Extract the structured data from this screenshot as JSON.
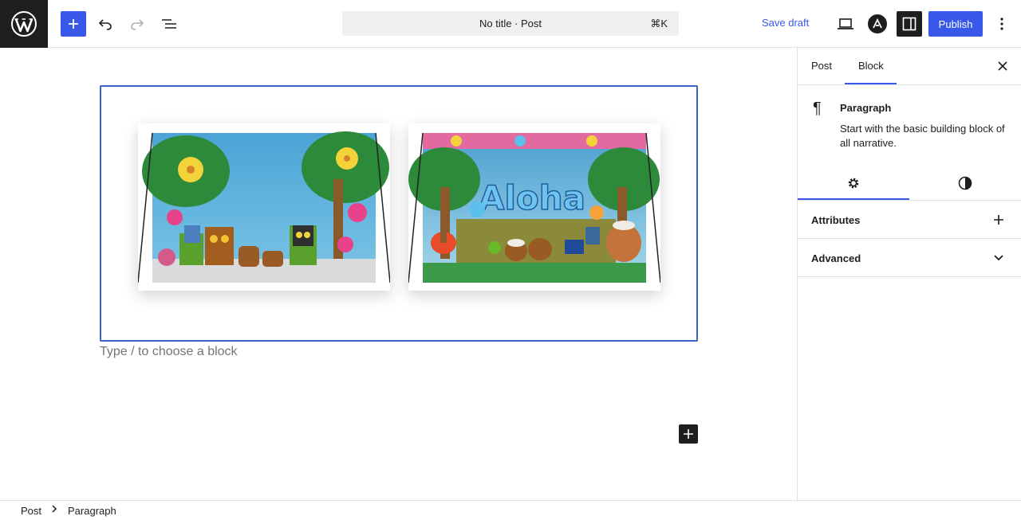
{
  "header": {
    "document_title": "No title · Post",
    "shortcut": "⌘K",
    "save_draft_label": "Save draft",
    "publish_label": "Publish",
    "accent_color": "#3858e9"
  },
  "editor": {
    "placeholder": "Type / to choose a block",
    "gallery": [
      {
        "name": "tiki-backdrop"
      },
      {
        "name": "aloha-backdrop",
        "text": "Aloha"
      }
    ]
  },
  "sidebar": {
    "tabs": [
      "Post",
      "Block"
    ],
    "active_tab": "Block",
    "block": {
      "title": "Paragraph",
      "description": "Start with the basic building block of all narrative."
    },
    "panels": [
      {
        "label": "Attributes",
        "icon": "plus-icon"
      },
      {
        "label": "Advanced",
        "icon": "chevron-down-icon"
      }
    ]
  },
  "breadcrumb": [
    "Post",
    "Paragraph"
  ]
}
